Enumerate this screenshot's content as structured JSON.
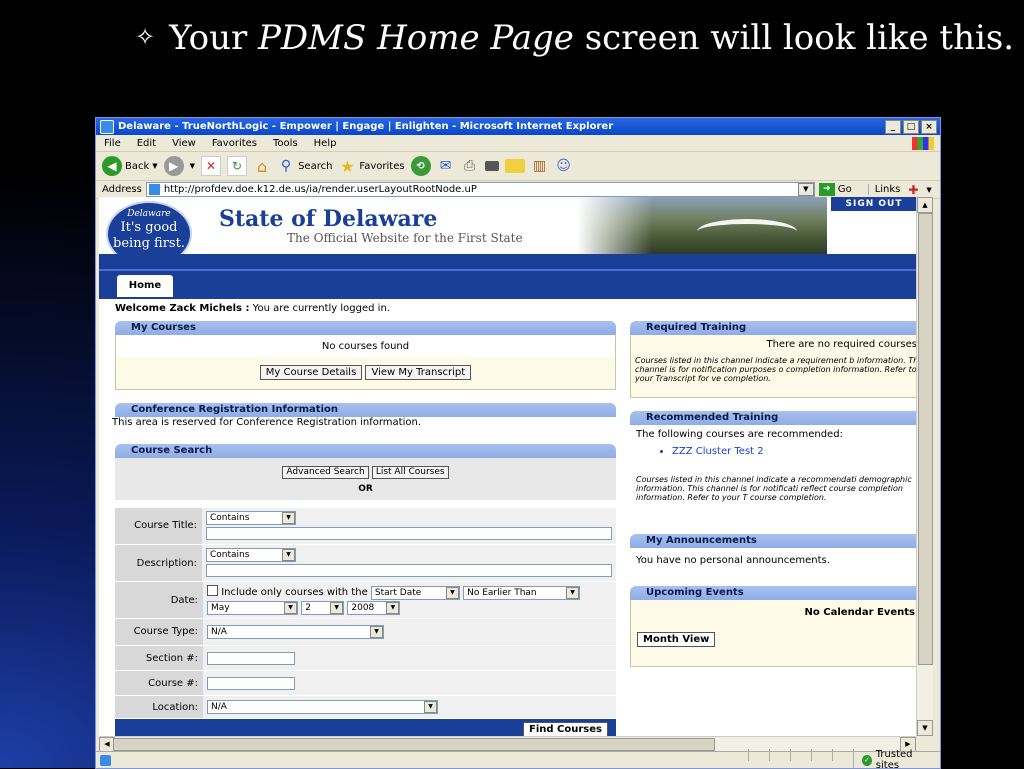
{
  "slide": {
    "bullet": "✧",
    "title_before": "Your ",
    "title_emph": "PDMS Home Page",
    "title_after": " screen will look like this."
  },
  "browser": {
    "window_title": "Delaware - TrueNorthLogic - Empower | Engage | Enlighten - Microsoft Internet Explorer",
    "menu": [
      "File",
      "Edit",
      "View",
      "Favorites",
      "Tools",
      "Help"
    ],
    "toolbar": {
      "back": "Back",
      "search": "Search",
      "favorites": "Favorites"
    },
    "address_label": "Address",
    "url": "http://profdev.doe.k12.de.us/ia/render.userLayoutRootNode.uP",
    "go_label": "Go",
    "links_label": "Links",
    "status_zone": "Trusted sites"
  },
  "site": {
    "seal_line1": "Delaware",
    "seal_line2": "It's good",
    "seal_line3": "being first.",
    "title": "State of Delaware",
    "subtitle": "The Official Website for the First State",
    "signout": "SIGN OUT",
    "tab_home": "Home",
    "welcome_name": "Welcome Zack Michels :",
    "welcome_rest": " You are currently logged in."
  },
  "my_courses": {
    "header": "My Courses",
    "empty": "No courses found",
    "btn_details": "My Course Details",
    "btn_transcript": "View My Transcript"
  },
  "conference": {
    "header": "Conference Registration Information",
    "text": "This area is reserved for Conference Registration information."
  },
  "course_search": {
    "header": "Course Search",
    "btn_advanced": "Advanced Search",
    "btn_list_all": "List All Courses",
    "or": "OR",
    "label_title": "Course Title:",
    "label_description": "Description:",
    "label_date": "Date:",
    "label_type": "Course Type:",
    "label_section": "Section #:",
    "label_course": "Course #:",
    "label_location": "Location:",
    "title_match": "Contains",
    "desc_match": "Contains",
    "date_checkbox": "Include only courses with the",
    "date_field": "Start Date",
    "date_op": "No Earlier Than",
    "month": "May",
    "day": "2",
    "year": "2008",
    "type_value": "N/A",
    "location_value": "N/A",
    "btn_find": "Find Courses"
  },
  "required_training": {
    "header": "Required Training",
    "status": "There are no required courses",
    "note": "Courses listed in this channel indicate a requirement b information. This channel is for notification purposes o completion information. Refer to your Transcript for ve completion."
  },
  "recommended_training": {
    "header": "Recommended Training",
    "intro": "The following courses are recommended:",
    "items": [
      "ZZZ Cluster Test 2"
    ],
    "note": "Courses listed in this channel indicate a recommendati demographic information. This channel is for notificati reflect course completion information. Refer to your T course completion."
  },
  "announcements": {
    "header": "My Announcements",
    "text": "You have no personal announcements."
  },
  "events": {
    "header": "Upcoming Events",
    "text": "No Calendar Events",
    "btn_month": "Month View"
  },
  "colors": {
    "navy": "#1a3f98",
    "panel_header": "#a8c0ee",
    "yellow_box": "#fdfbe8",
    "link": "#1a3fd8"
  }
}
